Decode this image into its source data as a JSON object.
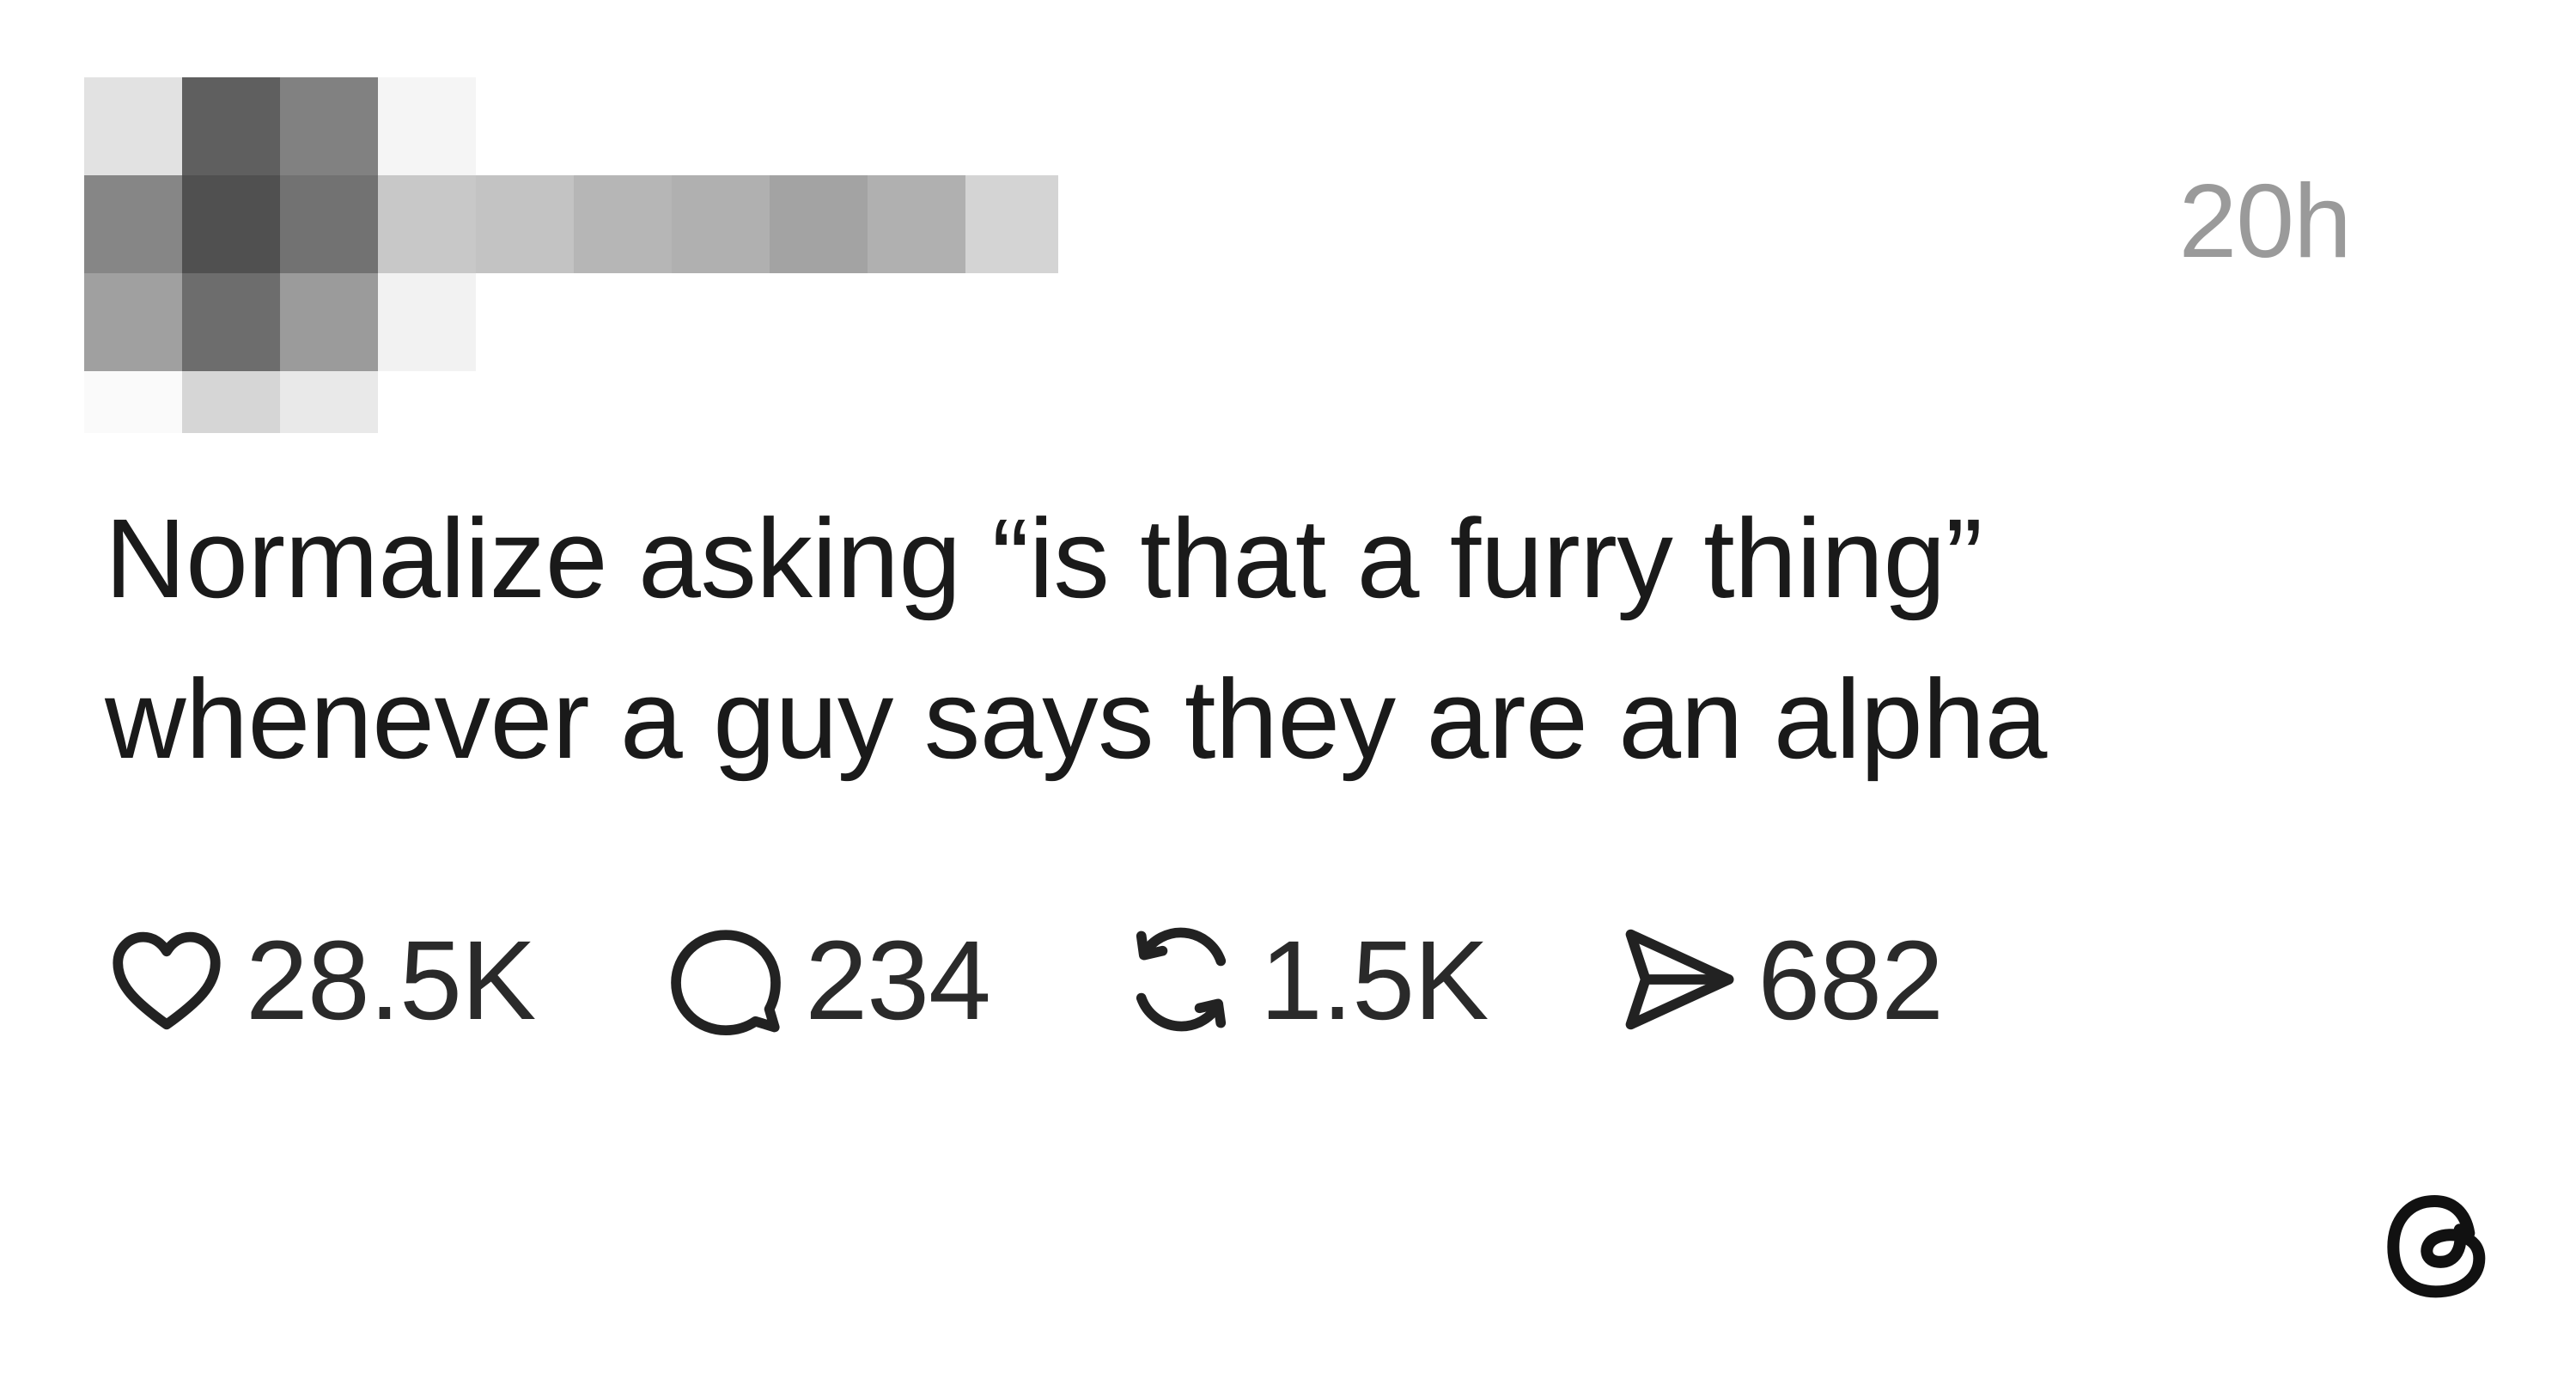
{
  "post": {
    "timestamp": "20h",
    "text_lines": [
      "Normalize asking “is that a furry thing”",
      "whenever a guy says they are an alpha"
    ],
    "actions": {
      "likes": "28.5K",
      "replies": "234",
      "reposts": "1.5K",
      "shares": "682"
    },
    "icons": {
      "like": "heart-icon",
      "reply": "speech-bubble-icon",
      "repost": "repost-arrows-icon",
      "share": "paper-plane-icon",
      "brand": "threads-logo"
    }
  }
}
